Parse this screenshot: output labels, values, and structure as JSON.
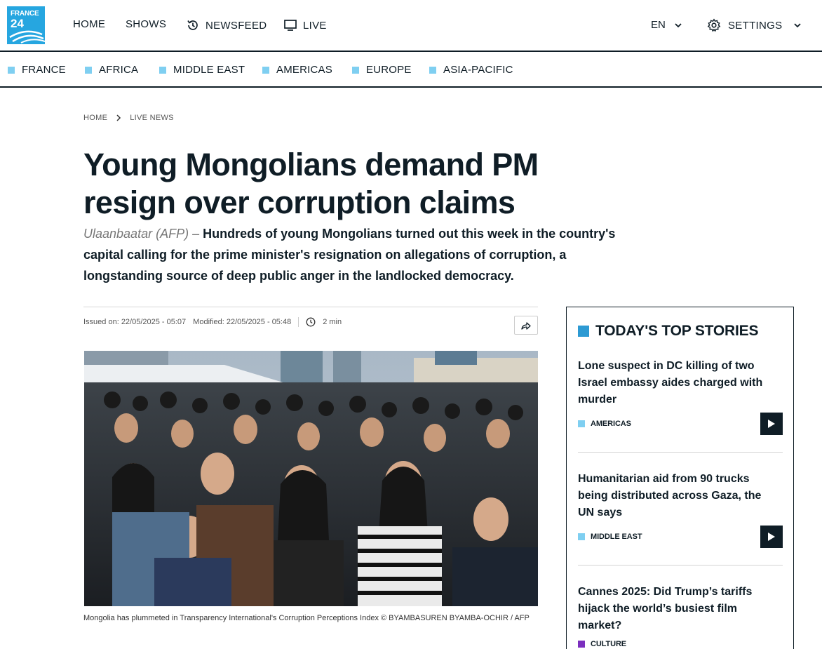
{
  "brand": {
    "logo_line1": "FRANCE",
    "logo_line2": "24",
    "brand_color": "#26a6e0"
  },
  "nav": {
    "home": "HOME",
    "shows": "SHOWS",
    "newsfeed": "NEWSFEED",
    "live": "LIVE",
    "language": "EN",
    "settings": "SETTINGS"
  },
  "regions": [
    "FRANCE",
    "AFRICA",
    "MIDDLE EAST",
    "AMERICAS",
    "EUROPE",
    "ASIA-PACIFIC"
  ],
  "breadcrumb": {
    "home": "HOME",
    "section": "LIVE NEWS"
  },
  "article": {
    "title": "Young Mongolians demand PM resign over corruption claims",
    "dateline": "Ulaanbaatar (AFP) –",
    "lede": "Hundreds of young Mongolians turned out this week in the country's capital calling for the prime minister's resignation on allegations of corruption, a longstanding source of deep public anger in the landlocked democracy.",
    "issued": "Issued on: 22/05/2025 - 05:07",
    "modified": "Modified: 22/05/2025 - 05:48",
    "read_time": "2 min",
    "caption": "Mongolia has plummeted in Transparency International's Corruption Perceptions Index  © BYAMBASUREN BYAMBA-OCHIR / AFP"
  },
  "sidebar": {
    "heading": "TODAY'S TOP STORIES",
    "stories": [
      {
        "headline": "Lone suspect in DC killing of two Israel embassy aides charged with murder",
        "tag": "AMERICAS",
        "tag_color": "#7fcff1"
      },
      {
        "headline": "Humanitarian aid from 90 trucks being distributed across Gaza, the UN says",
        "tag": "MIDDLE EAST",
        "tag_color": "#7fcff1"
      },
      {
        "headline": "Cannes 2025: Did Trump’s tariffs hijack the world’s busiest film market?",
        "tag": "CULTURE",
        "tag_color": "#7b2fbe"
      }
    ]
  }
}
